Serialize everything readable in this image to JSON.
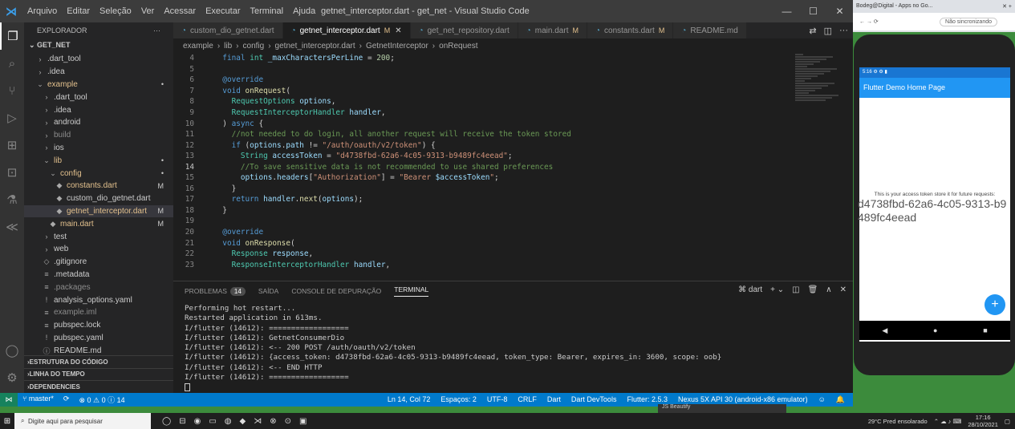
{
  "window": {
    "title": "getnet_interceptor.dart - get_net - Visual Studio Code",
    "menu": [
      "Arquivo",
      "Editar",
      "Seleção",
      "Ver",
      "Acessar",
      "Executar",
      "Terminal",
      "Ajuda"
    ]
  },
  "sidebar": {
    "header": "EXPLORADOR",
    "project": "GET_NET",
    "items": [
      {
        "label": ".dart_tool",
        "indent": 1,
        "icon": "›",
        "cls": ""
      },
      {
        "label": ".idea",
        "indent": 1,
        "icon": "›",
        "cls": ""
      },
      {
        "label": "example",
        "indent": 1,
        "icon": "⌄",
        "cls": "mod",
        "badge": "•"
      },
      {
        "label": ".dart_tool",
        "indent": 2,
        "icon": "›",
        "cls": ""
      },
      {
        "label": ".idea",
        "indent": 2,
        "icon": "›",
        "cls": ""
      },
      {
        "label": "android",
        "indent": 2,
        "icon": "›",
        "cls": ""
      },
      {
        "label": "build",
        "indent": 2,
        "icon": "›",
        "cls": "dim"
      },
      {
        "label": "ios",
        "indent": 2,
        "icon": "›",
        "cls": ""
      },
      {
        "label": "lib",
        "indent": 2,
        "icon": "⌄",
        "cls": "mod",
        "badge": "•"
      },
      {
        "label": "config",
        "indent": 3,
        "icon": "⌄",
        "cls": "mod",
        "badge": "•"
      },
      {
        "label": "constants.dart",
        "indent": 4,
        "icon": "◆",
        "cls": "mod",
        "badge": "M"
      },
      {
        "label": "custom_dio_getnet.dart",
        "indent": 4,
        "icon": "◆",
        "cls": ""
      },
      {
        "label": "getnet_interceptor.dart",
        "indent": 4,
        "icon": "◆",
        "cls": "mod",
        "badge": "M",
        "sel": true
      },
      {
        "label": "main.dart",
        "indent": 3,
        "icon": "◆",
        "cls": "mod",
        "badge": "M"
      },
      {
        "label": "test",
        "indent": 2,
        "icon": "›",
        "cls": ""
      },
      {
        "label": "web",
        "indent": 2,
        "icon": "›",
        "cls": ""
      },
      {
        "label": ".gitignore",
        "indent": 2,
        "icon": "◇",
        "cls": ""
      },
      {
        "label": ".metadata",
        "indent": 2,
        "icon": "≡",
        "cls": ""
      },
      {
        "label": ".packages",
        "indent": 2,
        "icon": "≡",
        "cls": "dim"
      },
      {
        "label": "analysis_options.yaml",
        "indent": 2,
        "icon": "!",
        "cls": ""
      },
      {
        "label": "example.iml",
        "indent": 2,
        "icon": "≡",
        "cls": "dim"
      },
      {
        "label": "pubspec.lock",
        "indent": 2,
        "icon": "≡",
        "cls": ""
      },
      {
        "label": "pubspec.yaml",
        "indent": 2,
        "icon": "!",
        "cls": ""
      },
      {
        "label": "README.md",
        "indent": 2,
        "icon": "ⓘ",
        "cls": ""
      }
    ],
    "sections": [
      "ESTRUTURA DO CÓDIGO",
      "LINHA DO TEMPO",
      "DEPENDENCIES"
    ]
  },
  "tabs": [
    {
      "label": "custom_dio_getnet.dart",
      "m": "",
      "active": false
    },
    {
      "label": "getnet_interceptor.dart",
      "m": "M",
      "active": true
    },
    {
      "label": "get_net_repository.dart",
      "m": "",
      "active": false
    },
    {
      "label": "main.dart",
      "m": "M",
      "active": false
    },
    {
      "label": "constants.dart",
      "m": "M",
      "active": false
    },
    {
      "label": "README.md",
      "m": "",
      "active": false
    }
  ],
  "breadcrumb": [
    "example",
    "›",
    "lib",
    "›",
    "config",
    "›",
    "getnet_interceptor.dart",
    "›",
    "GetnetInterceptor",
    "›",
    "onRequest"
  ],
  "code": [
    {
      "n": "4",
      "h": "  <span class='kw'>final</span> <span class='ty'>int</span> <span class='vr'>_maxCharactersPerLine</span> = <span class='nu'>200</span>;"
    },
    {
      "n": "5",
      "h": ""
    },
    {
      "n": "6",
      "h": "  <span class='an'>@override</span>"
    },
    {
      "n": "7",
      "h": "  <span class='kw'>void</span> <span class='fn'>onRequest</span>("
    },
    {
      "n": "8",
      "h": "    <span class='ty'>RequestOptions</span> <span class='vr'>options</span>,"
    },
    {
      "n": "9",
      "h": "    <span class='ty'>RequestInterceptorHandler</span> <span class='vr'>handler</span>,"
    },
    {
      "n": "10",
      "h": "  ) <span class='kw'>async</span> {"
    },
    {
      "n": "11",
      "h": "    <span class='cm'>//not needed to do login, all another request will receive the token stored</span>"
    },
    {
      "n": "12",
      "h": "    <span class='kw'>if</span> (<span class='vr'>options</span>.<span class='vr'>path</span> != <span class='st'>\"/auth/oauth/v2/token\"</span>) {"
    },
    {
      "n": "13",
      "h": "      <span class='ty'>String</span> <span class='vr'>accessToken</span> = <span class='st'>\"d4738fbd-62a6-4c05-9313-b9489fc4eead\"</span>;"
    },
    {
      "n": "14",
      "h": "      <span class='cm'>//To save sensitive data is not recommended to use shared preferences</span>",
      "cur": true
    },
    {
      "n": "15",
      "h": "      <span class='vr'>options</span>.<span class='vr'>headers</span>[<span class='st'>\"Authorization\"</span>] = <span class='st'>\"Bearer </span><span class='vr'>$accessToken</span><span class='st'>\"</span>;"
    },
    {
      "n": "16",
      "h": "    }"
    },
    {
      "n": "17",
      "h": "    <span class='kw'>return</span> <span class='vr'>handler</span>.<span class='fn'>next</span>(<span class='vr'>options</span>);"
    },
    {
      "n": "18",
      "h": "  }"
    },
    {
      "n": "19",
      "h": ""
    },
    {
      "n": "20",
      "h": "  <span class='an'>@override</span>"
    },
    {
      "n": "21",
      "h": "  <span class='kw'>void</span> <span class='fn'>onResponse</span>("
    },
    {
      "n": "22",
      "h": "    <span class='ty'>Response</span> <span class='vr'>response</span>,"
    },
    {
      "n": "23",
      "h": "    <span class='ty'>ResponseInterceptorHandler</span> <span class='vr'>handler</span>,"
    }
  ],
  "panel": {
    "tabs": [
      "PROBLEMAS",
      "SAÍDA",
      "CONSOLE DE DEPURAÇÃO",
      "TERMINAL"
    ],
    "problems_count": "14",
    "shell": "dart",
    "lines": [
      "Performing hot restart...",
      "Restarted application in 613ms.",
      "I/flutter (14612): ==================",
      "I/flutter (14612): GetnetConsumerDio",
      "I/flutter (14612): <-- 200 POST /auth/oauth/v2/token",
      "I/flutter (14612): {access_token: d4738fbd-62a6-4c05-9313-b9489fc4eead, token_type: Bearer, expires_in: 3600, scope: oob}",
      "I/flutter (14612): <-- END HTTP",
      "I/flutter (14612): =================="
    ]
  },
  "status": {
    "branch": "master*",
    "errors": "0",
    "warnings": "0",
    "info": "14",
    "right": [
      "Ln 14, Col 72",
      "Espaços: 2",
      "UTF-8",
      "CRLF",
      "Dart",
      "Dart DevTools",
      "Flutter: 2.5.3",
      "Nexus 5X API 30 (android-x86 emulator)"
    ]
  },
  "browser": {
    "tab": "Bodeg@Digital - Apps no Go...",
    "sync": "Não sincronizando"
  },
  "phone": {
    "time": "5:16",
    "appbar_title": "Flutter Demo Home Page",
    "message": "This is your access token store it for future requests:",
    "token": "d4738fbd-62a6-4c05-9313-b9489fc4eead",
    "fab": "+"
  },
  "taskbar": {
    "search": "Digite aqui para pesquisar",
    "weather": "29°C  Pred ensolarado",
    "time": "17:16",
    "date": "28/10/2021",
    "js_beautify": "JS Beautify"
  }
}
